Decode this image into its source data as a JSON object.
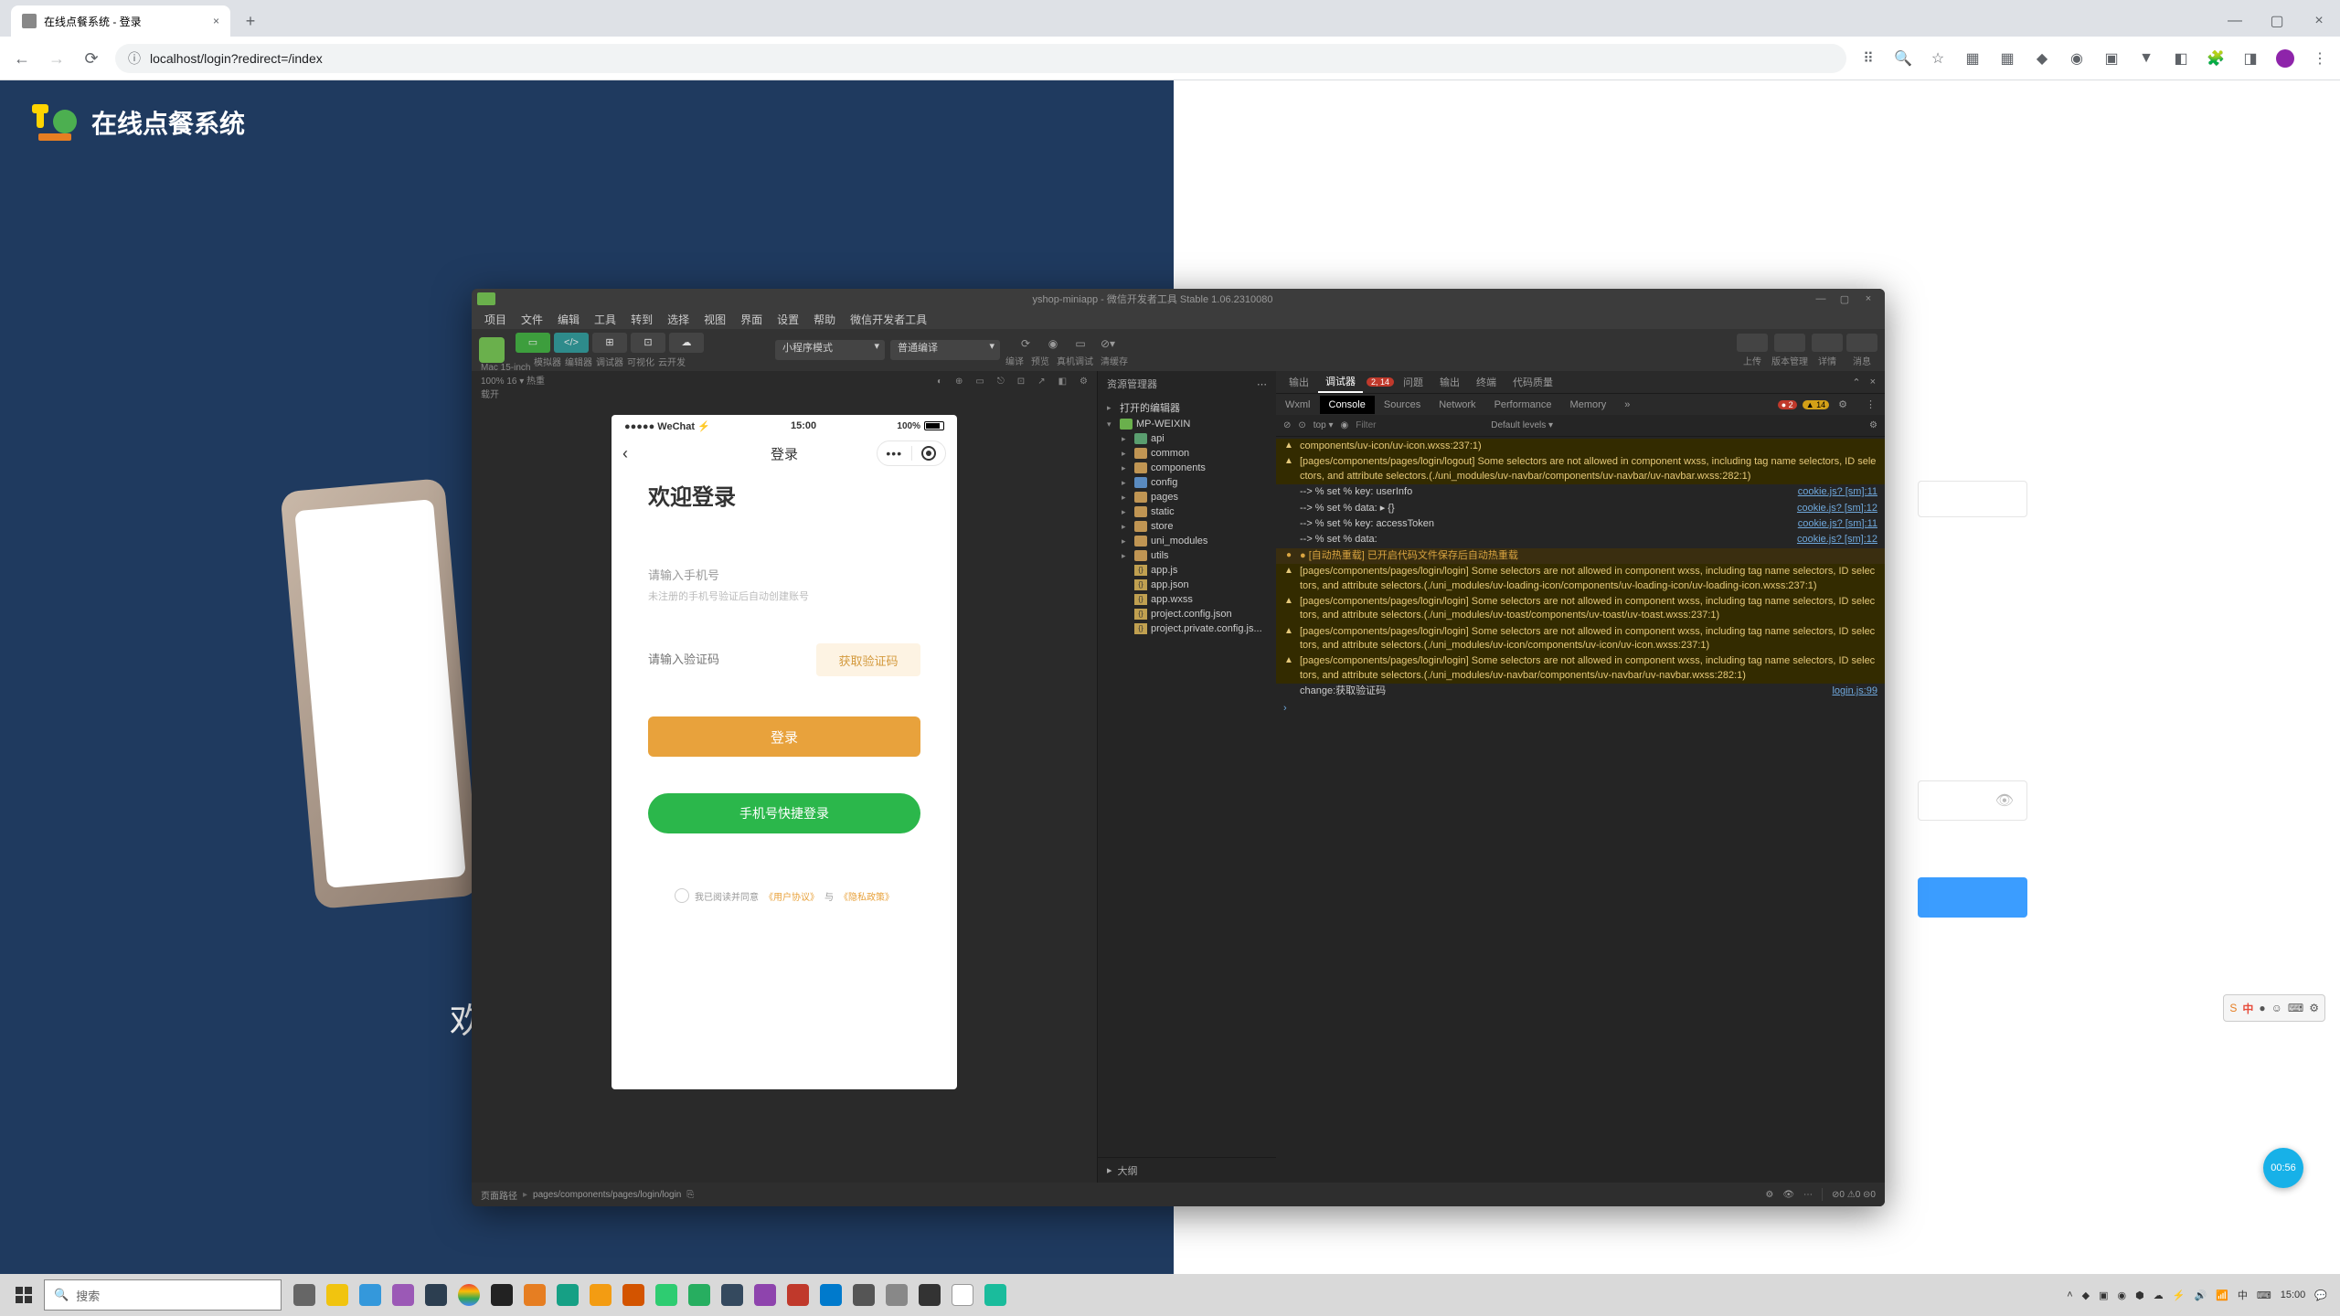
{
  "browser": {
    "tab_title": "在线点餐系统 - 登录",
    "url": "localhost/login?redirect=/index",
    "new_tab": "+"
  },
  "site": {
    "title": "在线点餐系统",
    "welcome_cut": "欢"
  },
  "devtools": {
    "title_center": "yshop-miniapp - 微信开发者工具 Stable 1.06.2310080",
    "menu": [
      "项目",
      "文件",
      "编辑",
      "工具",
      "转到",
      "选择",
      "视图",
      "界面",
      "设置",
      "帮助",
      "微信开发者工具"
    ],
    "modes": {
      "sim": "模拟器",
      "edit": "编辑器",
      "debug": "调试器",
      "vis": "可视化",
      "cloud": "云开发"
    },
    "compile_select": "小程序模式",
    "mode_select": "普通编译",
    "right_btns": {
      "upload": "上传",
      "ver": "版本管理",
      "detail": "详情",
      "msg": "消息"
    },
    "right_mid": {
      "compile": "编译",
      "preview": "预览",
      "remote": "真机调试",
      "clear": "清缓存"
    },
    "sim_info": "Mac 15-inch 100% 16 ▾   热重载开",
    "explorer": {
      "hdr": "资源管理器",
      "open_editors": "打开的编辑器",
      "root": "MP-WEIXIN",
      "items": [
        "api",
        "common",
        "components",
        "config",
        "pages",
        "static",
        "store",
        "uni_modules",
        "utils",
        "app.js",
        "app.json",
        "app.wxss",
        "project.config.json",
        "project.private.config.js..."
      ],
      "outline": "大纲"
    },
    "right_tabs": [
      "输出",
      "调试器",
      "问题",
      "输出",
      "终端",
      "代码质量"
    ],
    "right_tabs_badge": "2, 14",
    "sub_tabs": [
      "Wxml",
      "Console",
      "Sources",
      "Network",
      "Performance",
      "Memory"
    ],
    "err_counts": {
      "red": "2",
      "yellow": "14"
    },
    "filter": {
      "top": "top",
      "ph": "Filter",
      "levels": "Default levels"
    },
    "footer": {
      "label": "页面路径",
      "path": "pages/components/pages/login/login",
      "stats": "⊘0 ⚠0 ⊝0"
    }
  },
  "phone": {
    "carrier": "●●●●● WeChat ⚡",
    "time": "15:00",
    "battery": "100%",
    "nav_title": "登录",
    "h1": "欢迎登录",
    "label_phone": "请输入手机号",
    "hint": "未注册的手机号验证后自动创建账号",
    "code_ph": "请输入验证码",
    "get_code": "获取验证码",
    "login": "登录",
    "quick": "手机号快捷登录",
    "agree_pre": "我已阅读并同意",
    "agree_l1": "《用户协议》",
    "agree_mid": "与",
    "agree_l2": "《隐私政策》"
  },
  "console_lines": [
    {
      "type": "warn",
      "msg": "components/uv-icon/uv-icon.wxss:237:1)",
      "src": ""
    },
    {
      "type": "warn",
      "msg": "[pages/components/pages/login/logout] Some selectors are not allowed in component wxss, including tag name selectors, ID selectors, and attribute selectors.(./uni_modules/uv-navbar/components/uv-navbar/uv-navbar.wxss:282:1)",
      "src": ""
    },
    {
      "type": "log",
      "msg": "--> % set % key:\nuserInfo",
      "src": "cookie.js? [sm]:11"
    },
    {
      "type": "log",
      "msg": "--> % set % data:\n▸ {}",
      "src": "cookie.js? [sm]:12"
    },
    {
      "type": "log",
      "msg": "--> % set % key:\naccessToken",
      "src": "cookie.js? [sm]:11"
    },
    {
      "type": "log",
      "msg": "--> % set % data:",
      "src": "cookie.js? [sm]:12"
    },
    {
      "type": "oran",
      "msg": "● [自动热重载] 已开启代码文件保存后自动热重载",
      "src": ""
    },
    {
      "type": "warn",
      "msg": "[pages/components/pages/login/login] Some selectors are not allowed in component wxss, including tag name selectors, ID selectors, and attribute selectors.(./uni_modules/uv-loading-icon/components/uv-loading-icon/uv-loading-icon.wxss:237:1)",
      "src": ""
    },
    {
      "type": "warn",
      "msg": "[pages/components/pages/login/login] Some selectors are not allowed in component wxss, including tag name selectors, ID selectors, and attribute selectors.(./uni_modules/uv-toast/components/uv-toast/uv-toast.wxss:237:1)",
      "src": ""
    },
    {
      "type": "warn",
      "msg": "[pages/components/pages/login/login] Some selectors are not allowed in component wxss, including tag name selectors, ID selectors, and attribute selectors.(./uni_modules/uv-icon/components/uv-icon/uv-icon.wxss:237:1)",
      "src": ""
    },
    {
      "type": "warn",
      "msg": "[pages/components/pages/login/login] Some selectors are not allowed in component wxss, including tag name selectors, ID selectors, and attribute selectors.(./uni_modules/uv-navbar/components/uv-navbar/uv-navbar.wxss:282:1)",
      "src": ""
    },
    {
      "type": "log",
      "msg": "change:获取验证码",
      "src": "login.js:99"
    }
  ],
  "taskbar": {
    "search_ph": "搜索",
    "time": "15:00",
    "timer": "00:56"
  }
}
